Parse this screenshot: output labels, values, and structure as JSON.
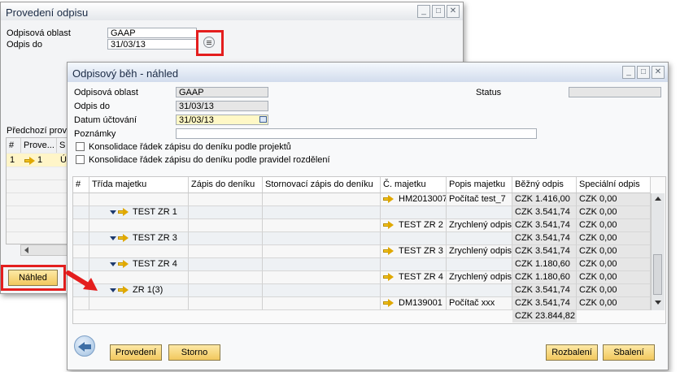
{
  "back_window": {
    "title": "Provedení odpisu",
    "fields": [
      {
        "label": "Odpisová oblast",
        "value": "GAAP"
      },
      {
        "label": "Odpis do",
        "value": "31/03/13"
      }
    ],
    "section_label": "Předchozí prove",
    "grid_headers": [
      "#",
      "Prove...",
      "S"
    ],
    "grid_row": {
      "num": "1",
      "value": "1",
      "third": "Ú"
    },
    "preview_button": "Náhled"
  },
  "front_window": {
    "title": "Odpisový běh - náhled",
    "fields": [
      {
        "label": "Odpisová oblast",
        "value": "GAAP"
      },
      {
        "label": "Odpis do",
        "value": "31/03/13"
      },
      {
        "label": "Datum účtování",
        "value": "31/03/13"
      },
      {
        "label": "Poznámky",
        "value": ""
      }
    ],
    "status_label": "Status",
    "status_value": "",
    "checkboxes": [
      "Konsolidace řádek zápisu do deníku podle projektů",
      "Konsolidace řádek zápisu do deníku podle pravidel rozdělení"
    ],
    "grid": {
      "headers": [
        "#",
        "Třída majetku",
        "Zápis do deníku",
        "Stornovací zápis do deníku",
        "Č. majetku",
        "Popis majetku",
        "Běžný odpis",
        "Speciální odpis"
      ],
      "rows": [
        {
          "cls": "",
          "asset": "HM2013007",
          "desc": "Počítač test_7",
          "b": "CZK 1.416,00",
          "s": "CZK 0,00",
          "kind": "asset"
        },
        {
          "cls": "TEST ZR 1",
          "asset": "",
          "desc": "",
          "b": "CZK 3.541,74",
          "s": "CZK 0,00",
          "kind": "group"
        },
        {
          "cls": "",
          "asset": "TEST ZR 2",
          "desc": "Zrychlený odpis",
          "b": "CZK 3.541,74",
          "s": "CZK 0,00",
          "kind": "asset"
        },
        {
          "cls": "TEST ZR 3",
          "asset": "",
          "desc": "",
          "b": "CZK 3.541,74",
          "s": "CZK 0,00",
          "kind": "group"
        },
        {
          "cls": "",
          "asset": "TEST ZR 3",
          "desc": "Zrychlený odpis",
          "b": "CZK 3.541,74",
          "s": "CZK 0,00",
          "kind": "asset"
        },
        {
          "cls": "TEST ZR 4",
          "asset": "",
          "desc": "",
          "b": "CZK 1.180,60",
          "s": "CZK 0,00",
          "kind": "group"
        },
        {
          "cls": "",
          "asset": "TEST ZR 4",
          "desc": "Zrychlený odpis",
          "b": "CZK 1.180,60",
          "s": "CZK 0,00",
          "kind": "asset"
        },
        {
          "cls": "ZR 1(3)",
          "asset": "",
          "desc": "",
          "b": "CZK 3.541,74",
          "s": "CZK 0,00",
          "kind": "group"
        },
        {
          "cls": "",
          "asset": "DM139001",
          "desc": "Počítač xxx",
          "b": "CZK 3.541,74",
          "s": "CZK 0,00",
          "kind": "asset"
        }
      ],
      "total": "CZK 23.844,82"
    },
    "buttons": {
      "execute": "Provedení",
      "cancel": "Storno",
      "expand": "Rozbalení",
      "collapse": "Sbalení"
    }
  },
  "colors": {
    "highlight_box": "#e41e1e",
    "button_fill": "#f2c85e",
    "title_text": "#1a2a44"
  }
}
